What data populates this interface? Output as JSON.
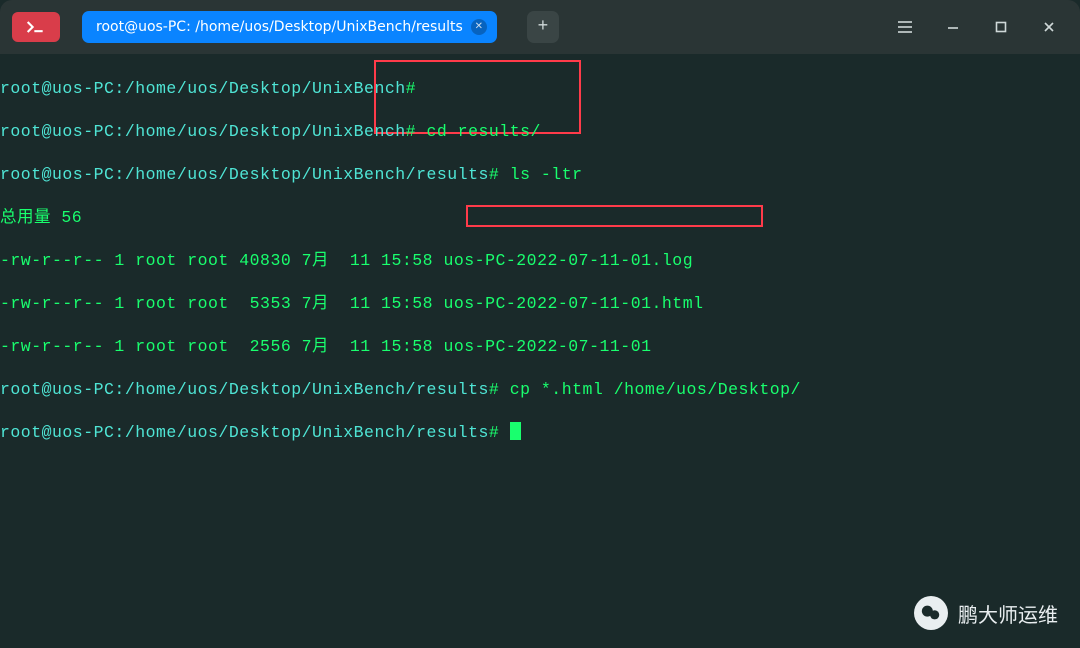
{
  "titlebar": {
    "tab_label": "root@uos-PC: /home/uos/Desktop/UnixBench/results",
    "new_tab_glyph": "+"
  },
  "term": {
    "prompt_base": "root@uos-PC:/home/uos/Desktop/UnixBench",
    "prompt_results": "root@uos-PC:/home/uos/Desktop/UnixBench/results",
    "hash": "#",
    "cmd_cd": " cd results/",
    "cmd_ls": " ls -ltr",
    "cmd_cp": " cp *.html /home/uos/Desktop/",
    "total_line": "总用量 56",
    "ls_rows": [
      "-rw-r--r-- 1 root root 40830 7月  11 15:58 uos-PC-2022-07-11-01.log",
      "-rw-r--r-- 1 root root  5353 7月  11 15:58 uos-PC-2022-07-11-01.html",
      "-rw-r--r-- 1 root root  2556 7月  11 15:58 uos-PC-2022-07-11-01"
    ]
  },
  "watermark": {
    "text": "鹏大师运维"
  }
}
